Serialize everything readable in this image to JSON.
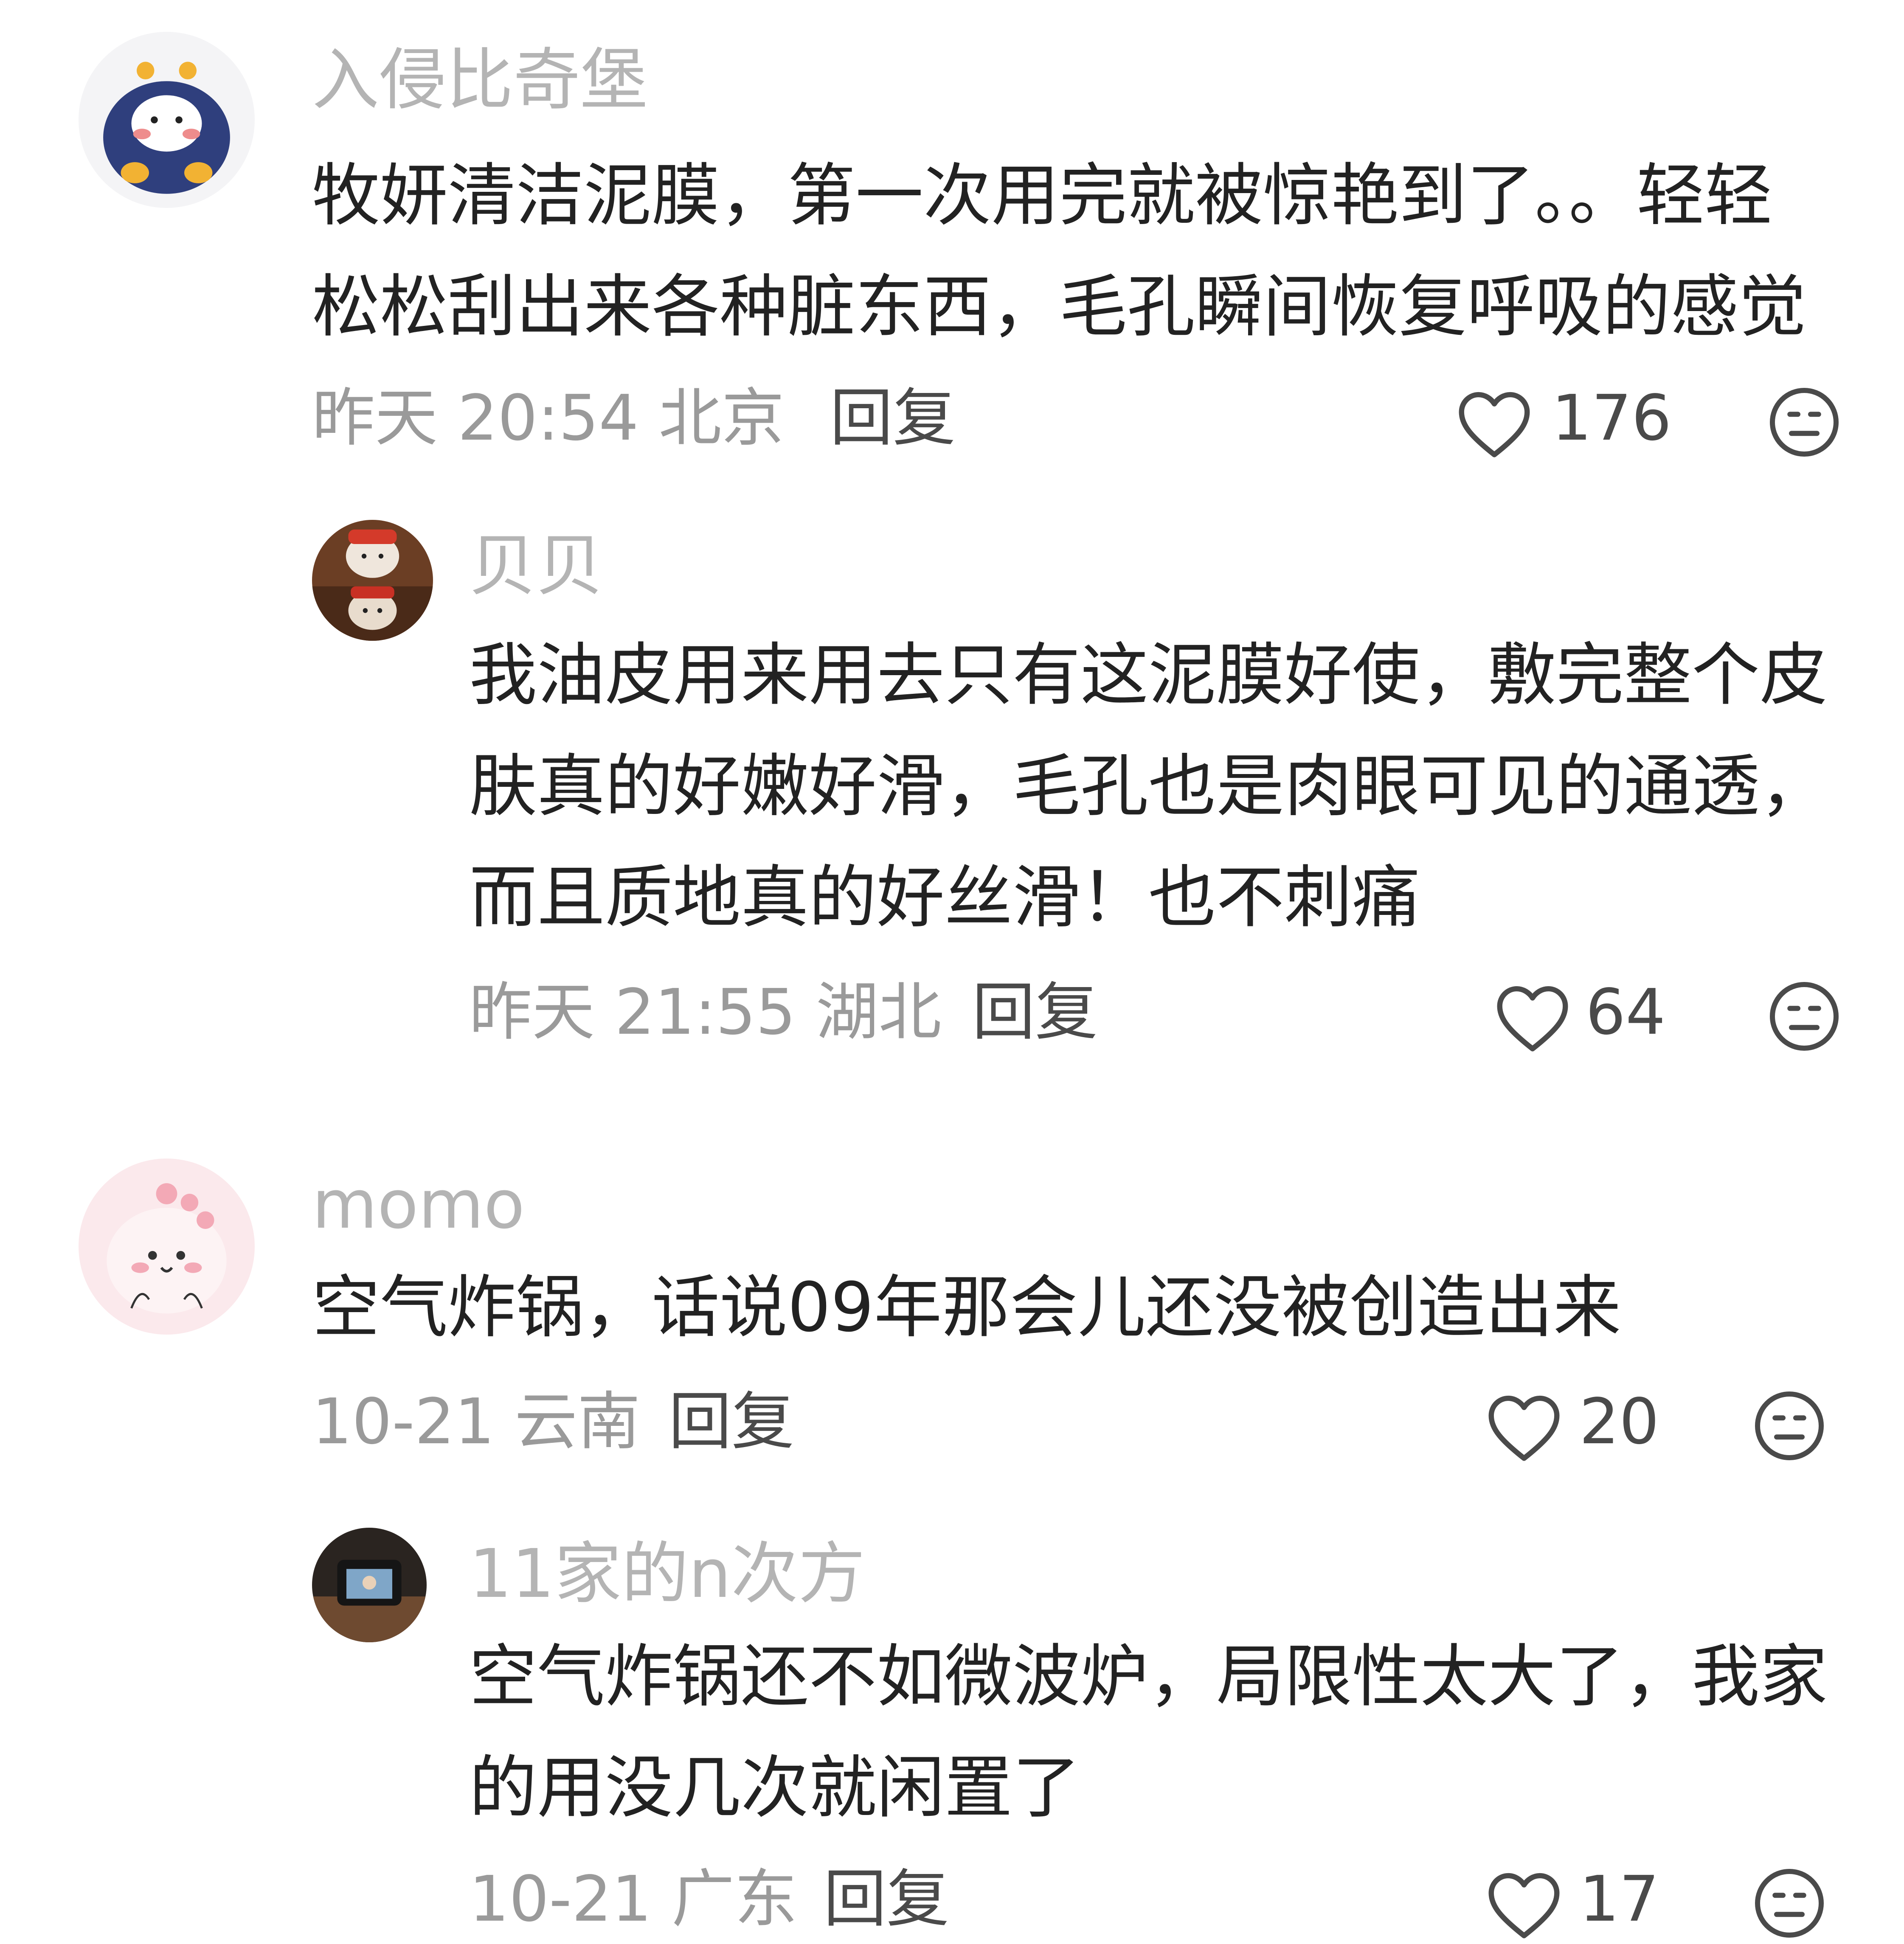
{
  "comments": [
    {
      "username": "入侵比奇堡",
      "text": "牧妍清洁泥膜，第一次用完就被惊艳到了。。轻轻松松刮出来各种脏东西，毛孔瞬间恢复呼吸的感觉",
      "time_location": "昨天 20:54 北京",
      "reply_label": "回复",
      "likes": "176",
      "avatar": "blue-hooded-character-avatar"
    },
    {
      "username": "贝贝",
      "text": "我油皮用来用去只有这泥膜好使，敷完整个皮肤真的好嫩好滑，毛孔也是肉眼可见的通透，而且质地真的好丝滑！也不刺痛",
      "time_location": "昨天 21:55 湖北",
      "reply_label": "回复",
      "likes": "64",
      "avatar": "dogs-photo-avatar"
    },
    {
      "username": "momo",
      "text": "空气炸锅，话说09年那会儿还没被创造出来",
      "time_location": "10-21 云南",
      "reply_label": "回复",
      "likes": "20",
      "avatar": "pink-dinosaur-avatar"
    },
    {
      "username": "11家的n次方",
      "text": "空气炸锅还不如微波炉，局限性太大了，我家的用没几次就闲置了",
      "time_location": "10-21 广东",
      "reply_label": "回复",
      "likes": "17",
      "avatar": "camera-photo-avatar"
    }
  ],
  "colors": {
    "username": "#b4b4b4",
    "text": "#222222",
    "meta": "#9a9a9a",
    "action": "#4a4a4a"
  },
  "icons": {
    "like": "heart-outline-icon",
    "dislike": "meh-face-icon"
  }
}
